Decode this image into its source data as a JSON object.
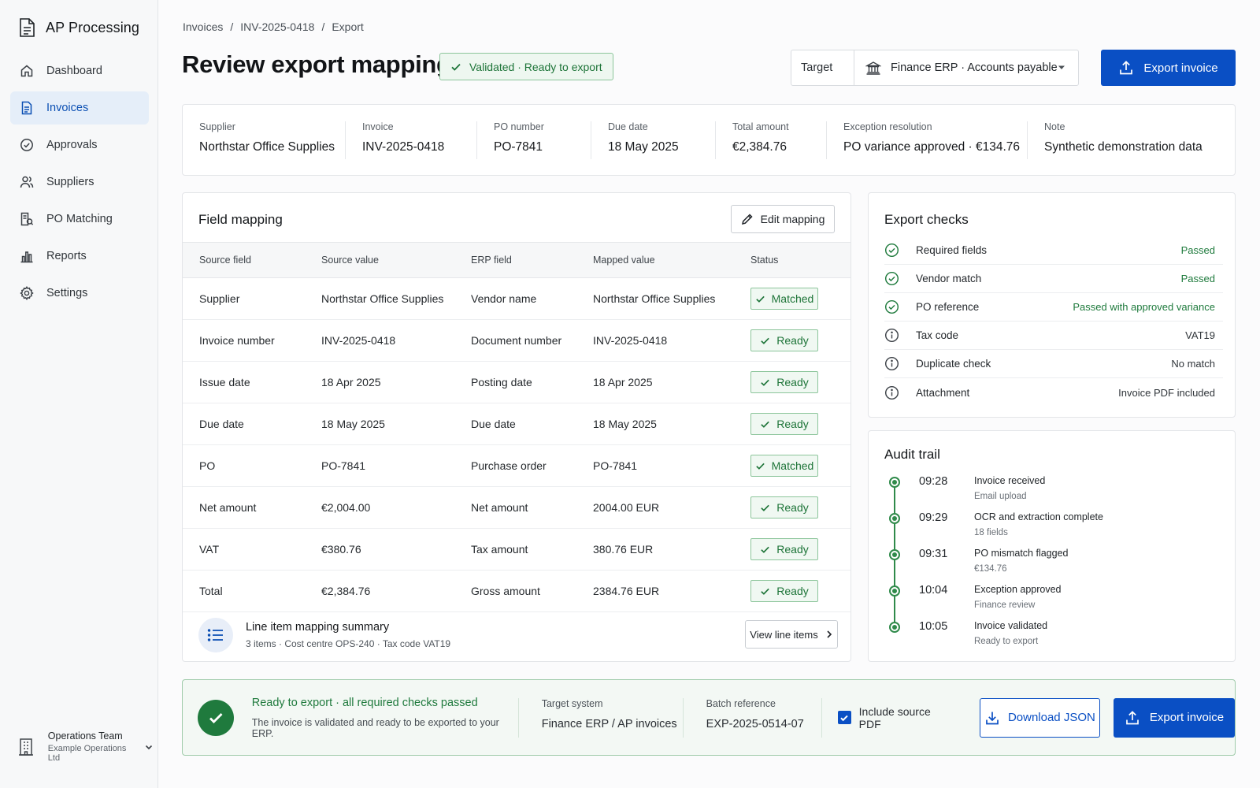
{
  "app": {
    "title": "AP Processing"
  },
  "sidebar": {
    "items": [
      {
        "label": "Dashboard",
        "icon": "home-icon",
        "active": false
      },
      {
        "label": "Invoices",
        "icon": "document-icon",
        "active": true
      },
      {
        "label": "Approvals",
        "icon": "check-circle-icon",
        "active": false
      },
      {
        "label": "Suppliers",
        "icon": "users-icon",
        "active": false
      },
      {
        "label": "PO Matching",
        "icon": "po-match-icon",
        "active": false
      },
      {
        "label": "Reports",
        "icon": "bar-chart-icon",
        "active": false
      },
      {
        "label": "Settings",
        "icon": "gear-icon",
        "active": false
      }
    ],
    "team": {
      "name": "Operations Team",
      "org": "Example Operations Ltd"
    }
  },
  "breadcrumb": {
    "items": [
      "Invoices",
      "INV-2025-0418",
      "Export"
    ],
    "separator": "/"
  },
  "page": {
    "title": "Review export mapping",
    "badge": "Validated · Ready to export"
  },
  "target": {
    "label": "Target",
    "value": "Finance ERP · Accounts payable"
  },
  "actions": {
    "export_label": "Export invoice"
  },
  "summary": [
    {
      "label": "Supplier",
      "value": "Northstar Office Supplies"
    },
    {
      "label": "Invoice",
      "value": "INV-2025-0418"
    },
    {
      "label": "PO number",
      "value": "PO-7841"
    },
    {
      "label": "Due date",
      "value": "18 May 2025"
    },
    {
      "label": "Total amount",
      "value": "€2,384.76"
    },
    {
      "label": "Exception resolution",
      "value": "PO variance approved · €134.76"
    },
    {
      "label": "Note",
      "value": "Synthetic demonstration data"
    }
  ],
  "mapping": {
    "title": "Field mapping",
    "edit_label": "Edit mapping",
    "columns": [
      "Source field",
      "Source value",
      "ERP field",
      "Mapped value",
      "Status"
    ],
    "rows": [
      {
        "source_field": "Supplier",
        "source_value": "Northstar Office Supplies",
        "erp_field": "Vendor name",
        "mapped_value": "Northstar Office Supplies",
        "status": "Matched"
      },
      {
        "source_field": "Invoice number",
        "source_value": "INV-2025-0418",
        "erp_field": "Document number",
        "mapped_value": "INV-2025-0418",
        "status": "Ready"
      },
      {
        "source_field": "Issue date",
        "source_value": "18 Apr 2025",
        "erp_field": "Posting date",
        "mapped_value": "18 Apr 2025",
        "status": "Ready"
      },
      {
        "source_field": "Due date",
        "source_value": "18 May 2025",
        "erp_field": "Due date",
        "mapped_value": "18 May 2025",
        "status": "Ready"
      },
      {
        "source_field": "PO",
        "source_value": "PO-7841",
        "erp_field": "Purchase order",
        "mapped_value": "PO-7841",
        "status": "Matched"
      },
      {
        "source_field": "Net amount",
        "source_value": "€2,004.00",
        "erp_field": "Net amount",
        "mapped_value": "2004.00 EUR",
        "status": "Ready"
      },
      {
        "source_field": "VAT",
        "source_value": "€380.76",
        "erp_field": "Tax amount",
        "mapped_value": "380.76 EUR",
        "status": "Ready"
      },
      {
        "source_field": "Total",
        "source_value": "€2,384.76",
        "erp_field": "Gross amount",
        "mapped_value": "2384.76 EUR",
        "status": "Ready"
      }
    ],
    "line_summary": {
      "title": "Line item mapping summary",
      "subtitle": "3 items · Cost centre OPS-240 · Tax code VAT19",
      "button": "View line items"
    }
  },
  "checks": {
    "title": "Export checks",
    "items": [
      {
        "label": "Required fields",
        "status": "Passed",
        "kind": "passed"
      },
      {
        "label": "Vendor match",
        "status": "Passed",
        "kind": "passed"
      },
      {
        "label": "PO reference",
        "status": "Passed with approved variance",
        "kind": "passed"
      },
      {
        "label": "Tax code",
        "status": "VAT19",
        "kind": "info"
      },
      {
        "label": "Duplicate check",
        "status": "No match",
        "kind": "info"
      },
      {
        "label": "Attachment",
        "status": "Invoice PDF included",
        "kind": "info"
      }
    ]
  },
  "audit": {
    "title": "Audit trail",
    "events": [
      {
        "time": "09:28",
        "event": "Invoice received",
        "detail": "Email upload"
      },
      {
        "time": "09:29",
        "event": "OCR and extraction complete",
        "detail": "18 fields"
      },
      {
        "time": "09:31",
        "event": "PO mismatch flagged",
        "detail": "€134.76"
      },
      {
        "time": "10:04",
        "event": "Exception approved",
        "detail": "Finance review"
      },
      {
        "time": "10:05",
        "event": "Invoice validated",
        "detail": "Ready to export"
      }
    ]
  },
  "footer": {
    "title": "Ready to export · all required checks passed",
    "subtitle": "The invoice is validated and ready to be exported to your ERP.",
    "target_label": "Target system",
    "target_value": "Finance ERP / AP invoices",
    "batch_label": "Batch reference",
    "batch_value": "EXP-2025-0514-07",
    "include_pdf_label": "Include source PDF",
    "include_pdf_checked": true,
    "download_label": "Download JSON",
    "export_label": "Export invoice"
  },
  "colors": {
    "primary": "#0a4fc4",
    "success": "#1e7a3c",
    "active_nav_bg": "#e5eef9"
  }
}
